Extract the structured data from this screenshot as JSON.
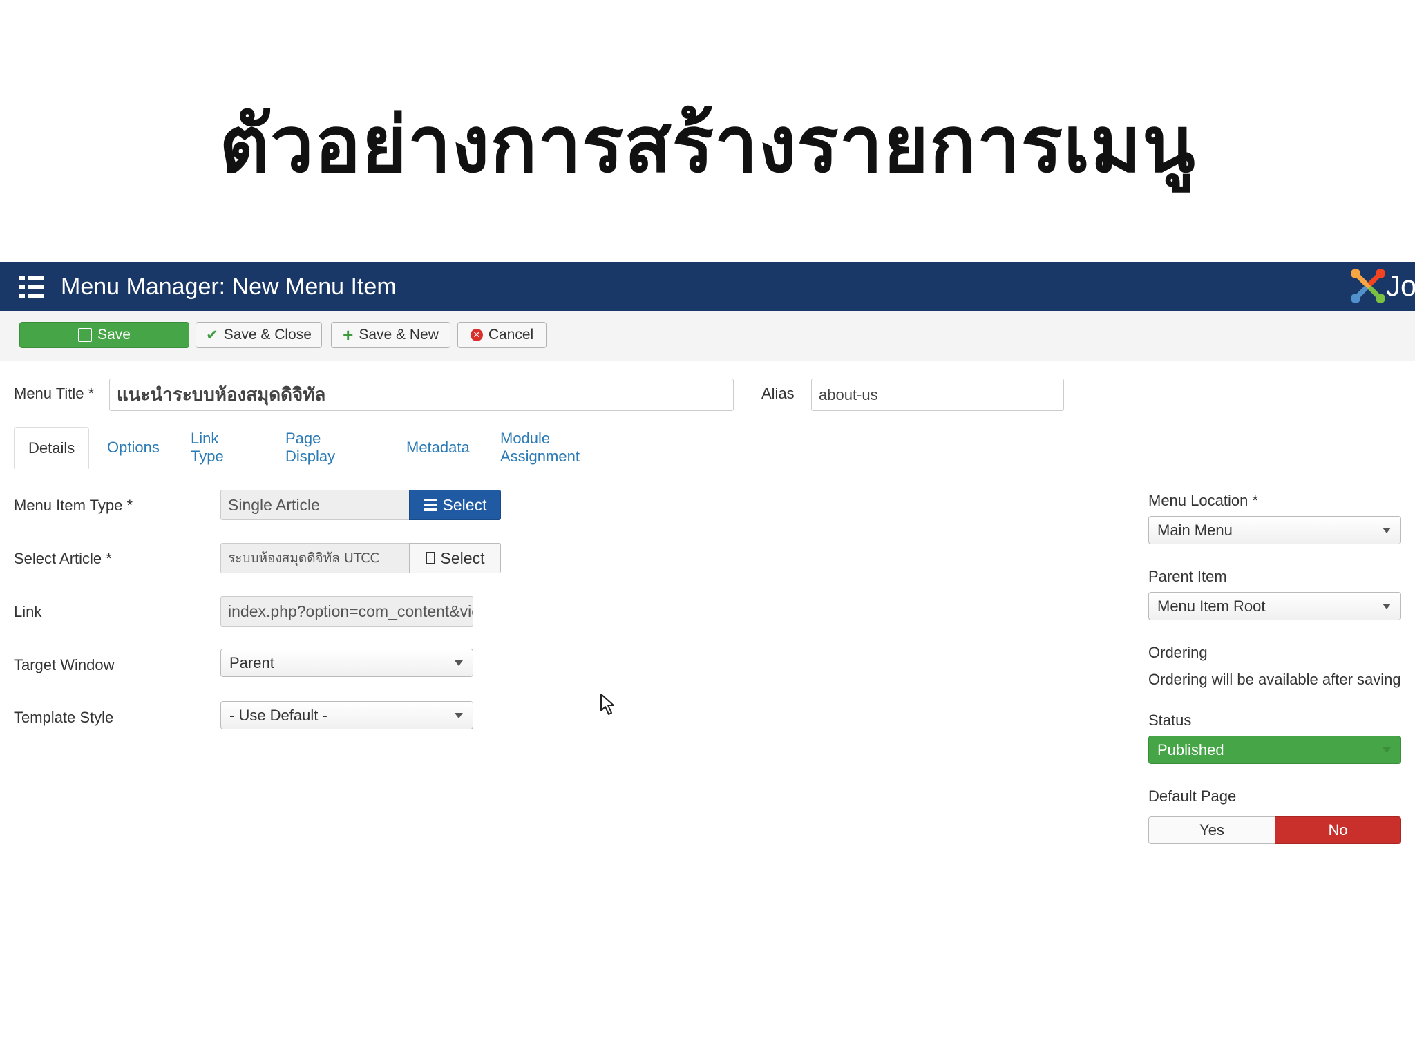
{
  "slide": {
    "title": "ตัวอย่างการสร้างรายการเมนู"
  },
  "header": {
    "title": "Menu Manager: New Menu Item",
    "logo_text": "Jo"
  },
  "toolbar": {
    "save_label": "Save",
    "save_close_label": "Save & Close",
    "save_new_label": "Save & New",
    "cancel_label": "Cancel"
  },
  "form": {
    "menu_title_label": "Menu Title *",
    "menu_title_value": "แนะนำระบบห้องสมุดดิจิทัล",
    "alias_label": "Alias",
    "alias_value": "about-us"
  },
  "tabs": [
    "Details",
    "Options",
    "Link Type",
    "Page Display",
    "Metadata",
    "Module Assignment"
  ],
  "details": {
    "menu_item_type_label": "Menu Item Type *",
    "menu_item_type_value": "Single Article",
    "select_label": "Select",
    "select_article_label": "Select Article *",
    "select_article_value": "ระบบห้องสมุดดิจิทัล UTCC",
    "link_label": "Link",
    "link_value": "index.php?option=com_content&view=article",
    "target_window_label": "Target Window",
    "target_window_value": "Parent",
    "template_style_label": "Template Style",
    "template_style_value": "- Use Default -"
  },
  "sidebar": {
    "menu_location_label": "Menu Location *",
    "menu_location_value": "Main Menu",
    "parent_item_label": "Parent Item",
    "parent_item_value": "Menu Item Root",
    "ordering_label": "Ordering",
    "ordering_note": "Ordering will be available after saving",
    "status_label": "Status",
    "status_value": "Published",
    "default_page_label": "Default Page",
    "yes_label": "Yes",
    "no_label": "No"
  },
  "colors": {
    "header_bg": "#1a3867",
    "save_green": "#46a546",
    "select_blue": "#1f5aa3",
    "no_red": "#c9302c",
    "link_blue": "#2a7ab5"
  }
}
